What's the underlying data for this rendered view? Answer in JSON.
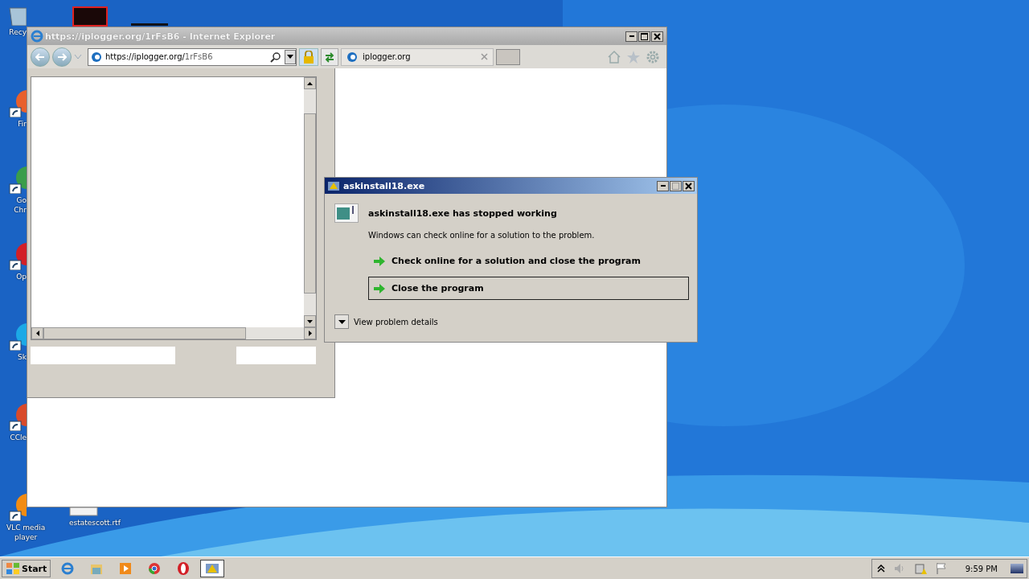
{
  "desktop_icons": [
    {
      "kind": "recycle",
      "lines": [
        "Recy"
      ]
    },
    {
      "kind": "firefox",
      "lines": [
        "Fir"
      ]
    },
    {
      "kind": "chrome",
      "lines": [
        "Go",
        "Chr"
      ]
    },
    {
      "kind": "opera",
      "lines": [
        "Op"
      ]
    },
    {
      "kind": "skype",
      "lines": [
        "Sk"
      ]
    },
    {
      "kind": "ccleaner",
      "lines": [
        "CCle"
      ]
    },
    {
      "kind": "vlc",
      "lines": [
        "VLC media",
        "player"
      ]
    },
    {
      "kind": "document",
      "lines": [
        "estatescott.rtf"
      ]
    }
  ],
  "browser": {
    "title": "https://iplogger.org/1rFsB6 - Internet Explorer",
    "address_host": "https://iplogger.org/",
    "address_path": "1rFsB6",
    "tabs": [
      {
        "label": "iplogger.org",
        "selected": true
      }
    ]
  },
  "dialog": {
    "title": "askinstall18.exe",
    "heading": "askinstall18.exe has stopped working",
    "message": "Windows can check online for a solution to the problem.",
    "options": [
      {
        "label": "Check online for a solution and close the program",
        "selected": false
      },
      {
        "label": "Close the program",
        "selected": true
      }
    ],
    "details": "View problem details"
  },
  "taskbar": {
    "start": "Start",
    "apps": [
      {
        "kind": "ie",
        "selected": false
      },
      {
        "kind": "folder",
        "selected": false
      },
      {
        "kind": "media",
        "selected": false
      },
      {
        "kind": "chrome",
        "selected": false
      },
      {
        "kind": "opera",
        "selected": false
      },
      {
        "kind": "error",
        "selected": true
      }
    ],
    "clock": "9:59 PM"
  }
}
